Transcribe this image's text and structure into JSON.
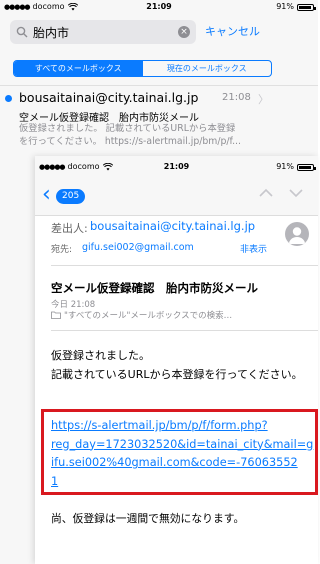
{
  "back_screen": {
    "status": {
      "carrier": "docomo",
      "time": "21:09",
      "battery": "91%"
    },
    "search": {
      "value": "胎内市",
      "cancel_label": "キャンセル"
    },
    "scope": {
      "all": "すべてのメールボックス",
      "current": "現在のメールボックス"
    },
    "result": {
      "from": "bousaitainai@city.tainai.lg.jp",
      "time": "21:08",
      "subject": "空メール仮登録確認　胎内市防災メール",
      "preview_line1": "仮登録されました。 記載されているURLから本登録",
      "preview_line2": "を行ってください。 https://s-alertmail.jp/bm/p/f..."
    }
  },
  "front_screen": {
    "status": {
      "carrier": "docomo",
      "time": "21:09",
      "battery": "91%"
    },
    "nav": {
      "count": "205"
    },
    "header": {
      "from_label": "差出人:",
      "from": "bousaitainai@city.tainai.lg.jp",
      "to_label": "宛先:",
      "to": "gifu.sei002@gmail.com",
      "hide_label": "非表示"
    },
    "message": {
      "subject": "空メール仮登録確認　胎内市防災メール",
      "date": "今日 21:08",
      "folder": "\"すべてのメール\"メールボックスでの検索…",
      "body_line1": "仮登録されました。",
      "body_line2": "記載されているURLから本登録を行ってくださ",
      "body_line2_end": "い。",
      "link": "https://s-alertmail.jp/bm/p/f/form.php?reg_day=1723032520&id=tainai_city&mail=gifu.sei002%40gmail.com&code=-760635521",
      "link_lines": [
        "https://s-alertmail.jp/bm/p/f/form.php?",
        "reg_day=1723032520&id=tainai_city&mail=g",
        "ifu.sei002%40gmail.com&code=-76063552",
        "1"
      ],
      "body_line3": "尚、仮登録は一週間で無効になります。"
    },
    "colors": {
      "accent": "#0a7bff",
      "highlight": "#d9181f"
    }
  }
}
